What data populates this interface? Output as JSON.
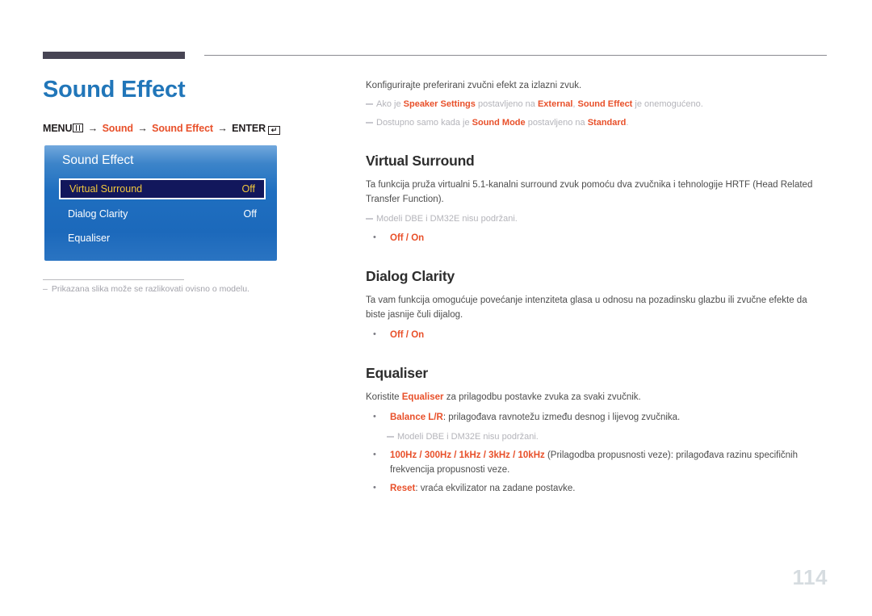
{
  "page": {
    "title": "Sound Effect",
    "number": "114",
    "accent_color": "#e8502a",
    "title_color": "#2176b9",
    "rule_color": "#474554"
  },
  "menu_path": {
    "menu_label": "MENU",
    "menu_icon": "menu-bars-icon",
    "arrow": "→",
    "step1": "Sound",
    "step2": "Sound Effect",
    "enter_label": "ENTER",
    "enter_icon": "enter-key-icon",
    "enter_glyph": "↵"
  },
  "osd": {
    "title": "Sound Effect",
    "rows": [
      {
        "label": "Virtual Surround",
        "value": "Off",
        "selected": true
      },
      {
        "label": "Dialog Clarity",
        "value": "Off",
        "selected": false
      },
      {
        "label": "Equaliser",
        "value": "",
        "selected": false
      }
    ],
    "highlight_bg": "#12175c",
    "highlight_text": "#f2c83c"
  },
  "left_note": {
    "dash": "–",
    "text": "Prikazana slika može se razlikovati ovisno o modelu."
  },
  "intro": {
    "lead": "Konfigurirajte preferirani zvučni efekt za izlazni zvuk.",
    "note1_a": "Ako je ",
    "note1_b": "Speaker Settings",
    "note1_c": " postavljeno na ",
    "note1_d": "External",
    "note1_e": ", ",
    "note1_f": "Sound Effect",
    "note1_g": " je onemogućeno.",
    "note2_a": "Dostupno samo kada je ",
    "note2_b": "Sound Mode",
    "note2_c": " postavljeno na ",
    "note2_d": "Standard",
    "note2_e": "."
  },
  "virtual_surround": {
    "heading": "Virtual Surround",
    "body": "Ta funkcija pruža virtualni 5.1-kanalni surround zvuk pomoću dva zvučnika i tehnologije HRTF (Head Related Transfer Function).",
    "note": "Modeli DBE i DM32E nisu podržani.",
    "option_off": "Off",
    "option_sep": " / ",
    "option_on": "On"
  },
  "dialog_clarity": {
    "heading": "Dialog Clarity",
    "body": "Ta vam funkcija omogućuje povećanje intenziteta glasa u odnosu na pozadinsku glazbu ili zvučne efekte da biste jasnije čuli dijalog.",
    "option_off": "Off",
    "option_sep": " / ",
    "option_on": "On"
  },
  "equaliser": {
    "heading": "Equaliser",
    "body_a": "Koristite ",
    "body_b": "Equaliser",
    "body_c": " za prilagodbu postavke zvuka za svaki zvučnik.",
    "bullet1_a": "Balance L/R",
    "bullet1_b": ": prilagođava ravnotežu između desnog i lijevog zvučnika.",
    "bullet1_note": "Modeli DBE i DM32E nisu podržani.",
    "bullet2_a": "100Hz / 300Hz / 1kHz / 3kHz / 10kHz",
    "bullet2_b": " (Prilagodba propusnosti veze): prilagođava razinu specifičnih frekvencija propusnosti veze.",
    "bullet3_a": "Reset",
    "bullet3_b": ": vraća ekvilizator na zadane postavke."
  }
}
